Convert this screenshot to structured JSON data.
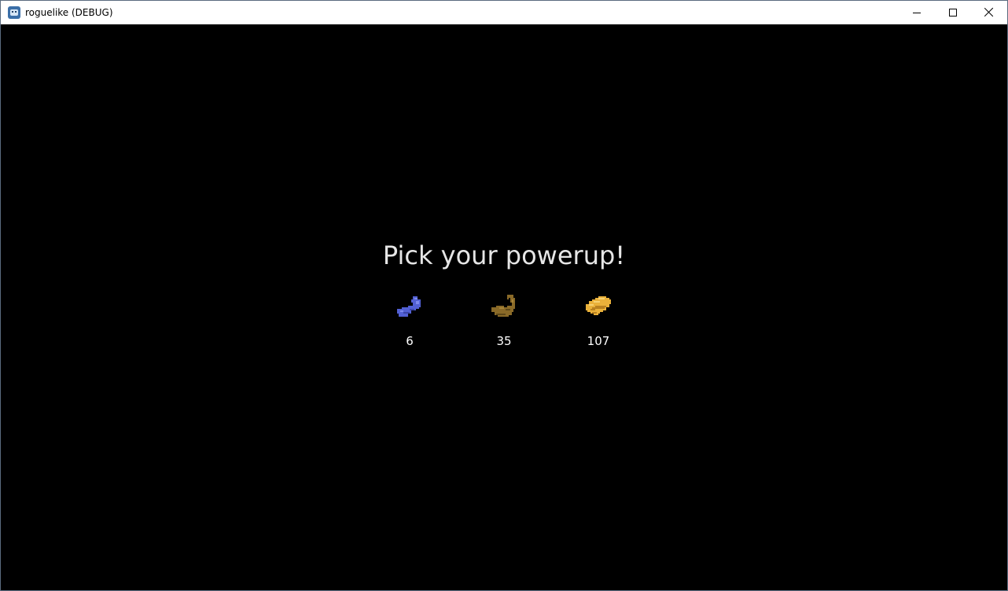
{
  "window": {
    "title": "roguelike (DEBUG)"
  },
  "game": {
    "prompt": "Pick your powerup!",
    "powerups": [
      {
        "icon": "sock-icon",
        "value": "6",
        "color": "#5260d4"
      },
      {
        "icon": "flexed-arm-icon",
        "value": "35",
        "color": "#8a6a28"
      },
      {
        "icon": "gold-bar-icon",
        "value": "107",
        "color": "#eab13a"
      }
    ]
  }
}
